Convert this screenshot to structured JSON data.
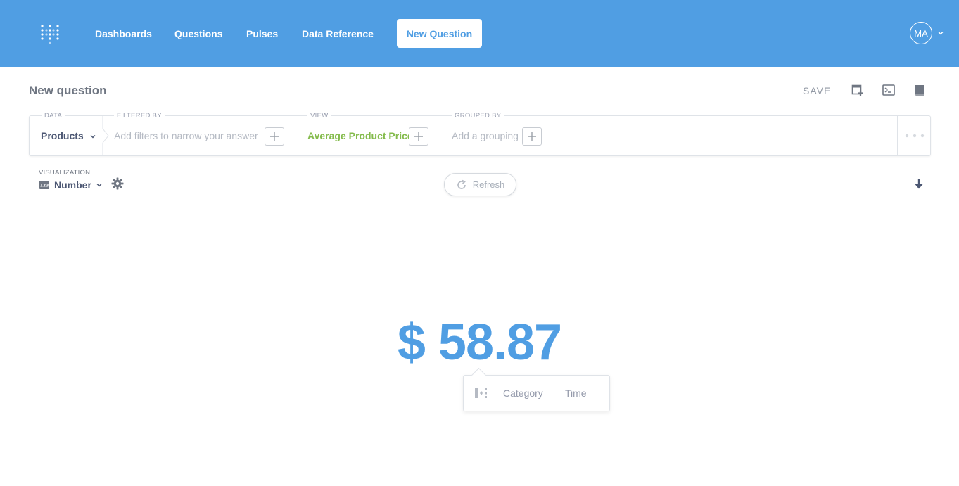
{
  "nav": {
    "links": [
      "Dashboards",
      "Questions",
      "Pulses",
      "Data Reference"
    ],
    "new_question": "New Question",
    "avatar_initials": "MA",
    "bg_color": "#509ee3"
  },
  "header": {
    "title": "New question",
    "save_label": "SAVE",
    "icons": [
      "add-to-dashboard-icon",
      "sql-console-icon",
      "data-reference-icon"
    ]
  },
  "query": {
    "data_label": "DATA",
    "data_value": "Products",
    "filter_label": "FILTERED BY",
    "filter_placeholder": "Add filters to narrow your answer",
    "view_label": "VIEW",
    "view_value": "Average Product Price",
    "group_label": "GROUPED BY",
    "group_placeholder": "Add a grouping"
  },
  "visualization": {
    "label": "VISUALIZATION",
    "type": "Number",
    "refresh_label": "Refresh"
  },
  "result": {
    "value": "$ 58.87",
    "breakout_options": [
      "Category",
      "Time"
    ]
  }
}
